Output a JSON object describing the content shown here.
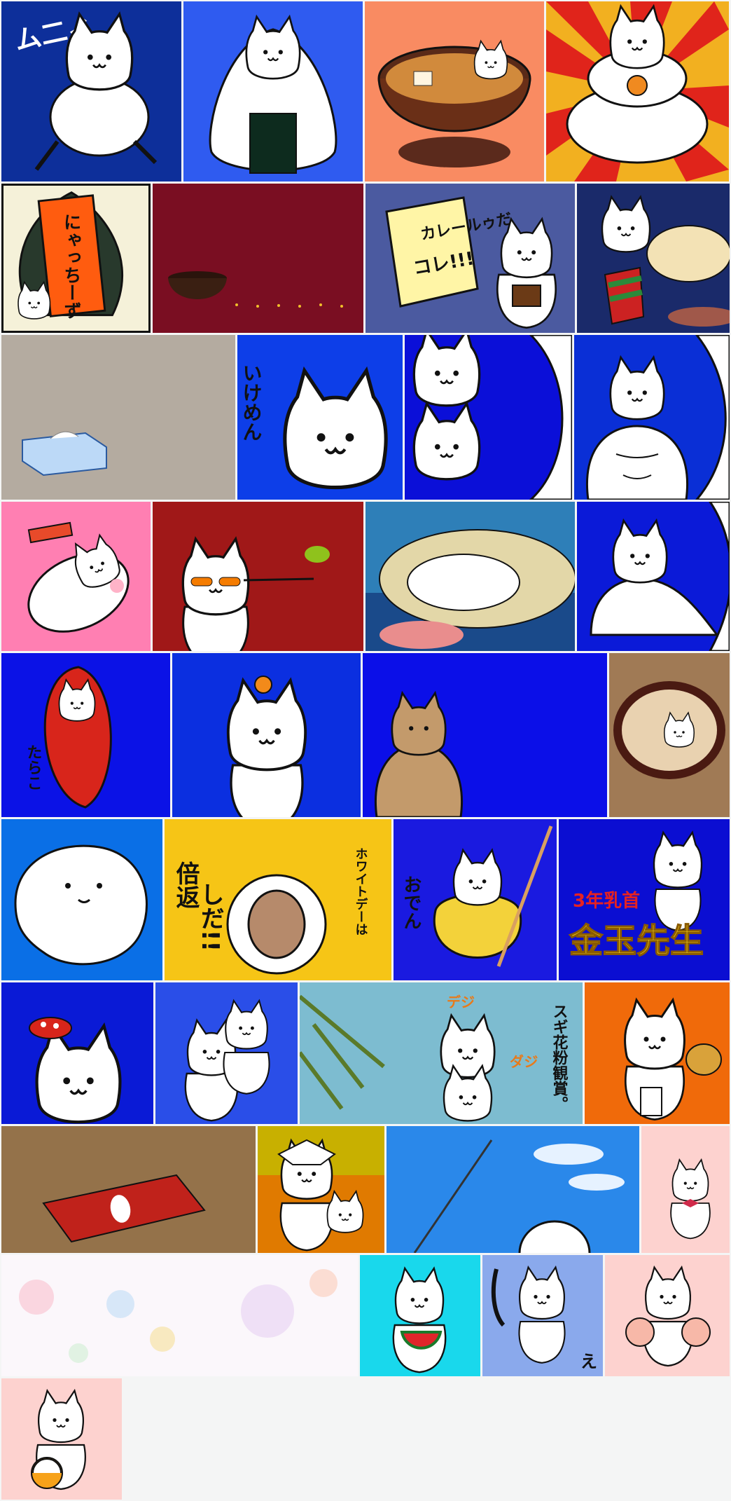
{
  "gallery": {
    "background": "#f4f5f5",
    "texts": {
      "muni": "ム二ィ",
      "nyacchiizu": "にゃっちーず",
      "curry_1": "カレールゥだ",
      "curry_2": "コレ!!!",
      "ikemen": "いけめん",
      "tarako": "たらこ",
      "whiteday": "ホワイトデーは",
      "baigaeshi_1": "倍返",
      "baigaeshi_2": "しだ!!",
      "oden": "おでん",
      "kinpachi_1": "3年乳首",
      "kinpachi_2": "金玉先生",
      "sugi": "スギ花粉観賞。",
      "dejishi_1": "デジ",
      "dejishi_2": "ダジ",
      "e": "え"
    },
    "tiles": [
      {
        "name": "muni-cat-tile"
      },
      {
        "name": "onigiri-cat-tile"
      },
      {
        "name": "miso-soup-cat-tile"
      },
      {
        "name": "kagami-mochi-cat-tile"
      },
      {
        "name": "nyacchiizu-banner-tile"
      },
      {
        "name": "empty-bowl-tile"
      },
      {
        "name": "curry-roux-cat-tile"
      },
      {
        "name": "christmas-stocking-cat-tile"
      },
      {
        "name": "tissue-box-tile"
      },
      {
        "name": "ikemen-cat-tile"
      },
      {
        "name": "double-cat-tile"
      },
      {
        "name": "muscle-cat-tile"
      },
      {
        "name": "pink-rolling-cat-tile"
      },
      {
        "name": "sunglasses-cat-tile"
      },
      {
        "name": "sleeping-cat-tile"
      },
      {
        "name": "blob-cat-tile"
      },
      {
        "name": "tarako-cat-tile"
      },
      {
        "name": "mikan-cat-tile"
      },
      {
        "name": "brown-cat-tile"
      },
      {
        "name": "bath-bowl-cat-tile"
      },
      {
        "name": "sideways-cat-tile"
      },
      {
        "name": "whiteday-astronaut-tile"
      },
      {
        "name": "oden-cat-tile"
      },
      {
        "name": "kinpachi-cat-tile"
      },
      {
        "name": "mushroom-cat-tile"
      },
      {
        "name": "hugging-cats-tile"
      },
      {
        "name": "cedar-pollen-cats-tile"
      },
      {
        "name": "teapot-cat-tile"
      },
      {
        "name": "red-packet-tile"
      },
      {
        "name": "kabuto-cats-tile"
      },
      {
        "name": "sky-kite-cat-tile"
      },
      {
        "name": "cake-cat-tile"
      },
      {
        "name": "balloons-tile"
      },
      {
        "name": "watermelon-cat-tile"
      },
      {
        "name": "e-cat-tile"
      },
      {
        "name": "pink-cheeks-cat-tile"
      },
      {
        "name": "ball-cat-tile"
      }
    ]
  }
}
